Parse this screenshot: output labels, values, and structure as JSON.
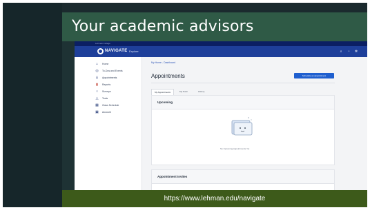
{
  "slide": {
    "title": "Your academic advisors",
    "caption": "https://www.lehman.edu/navigate"
  },
  "app": {
    "topbar_text": "Lehman College",
    "logo_text": "NAVIGATE",
    "nav_link": "Explore",
    "nav_icons": [
      "search-icon",
      "bell-icon",
      "gear-icon"
    ],
    "sidebar": {
      "items": [
        {
          "icon": "home-icon",
          "label": "Home"
        },
        {
          "icon": "check-icon",
          "label": "To-Dos and Events"
        },
        {
          "icon": "person-icon",
          "label": "Appointments"
        },
        {
          "icon": "flag-icon",
          "label": "Reports"
        },
        {
          "icon": "search-icon",
          "label": "Surveys"
        },
        {
          "icon": "tools-icon",
          "label": "Tools"
        },
        {
          "icon": "calendar-icon",
          "label": "Class Schedule"
        },
        {
          "icon": "account-icon",
          "label": "Account"
        }
      ]
    },
    "breadcrumb": "My Home - Dashboard",
    "page_title": "Appointments",
    "primary_button": "Schedule an Appointment",
    "tabs": [
      "My Appointments",
      "My Team",
      "History"
    ],
    "active_tab": 0,
    "cards": [
      {
        "title": "Upcoming",
        "empty_text": "No Upcoming Appointments Yet"
      },
      {
        "title": "Appointment Invites",
        "empty_text": ""
      }
    ],
    "colors": {
      "navbar": "#1e3f9a",
      "primary": "#1f5fcf",
      "slide_bg": "#1b2a2e",
      "title_band": "#2f5a46",
      "caption_band": "#3d5a1a"
    }
  }
}
